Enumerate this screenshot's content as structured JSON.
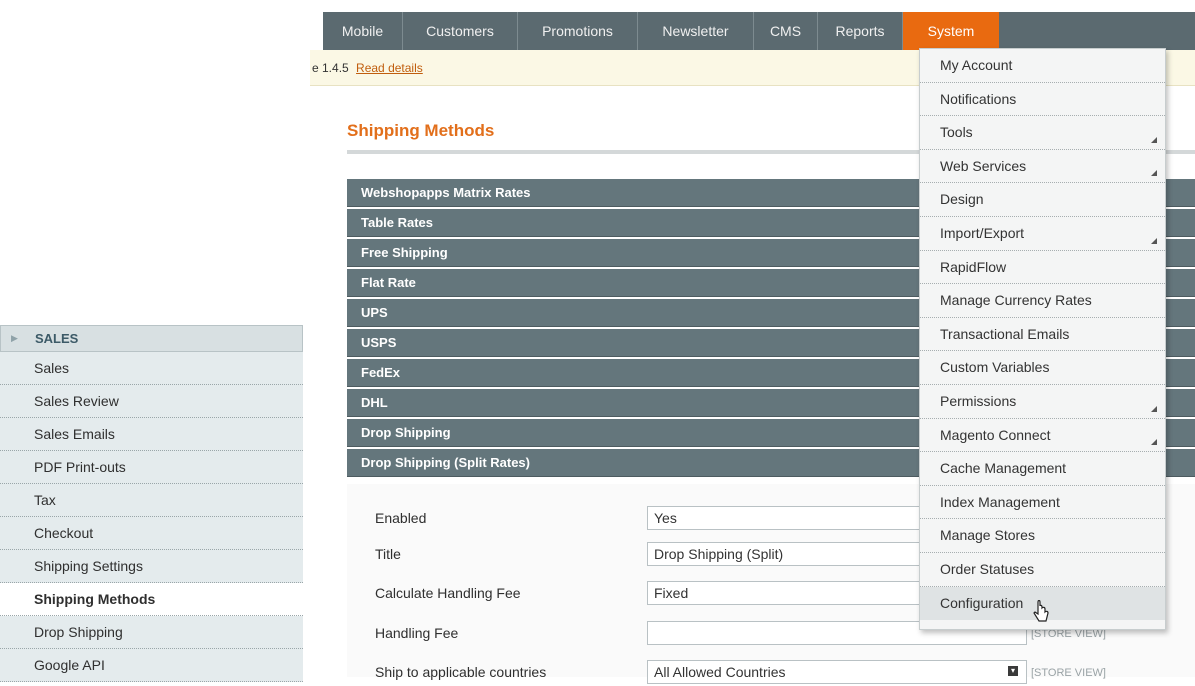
{
  "nav": {
    "items": [
      {
        "label": "Mobile",
        "width": 80
      },
      {
        "label": "Customers",
        "width": 115
      },
      {
        "label": "Promotions",
        "width": 120
      },
      {
        "label": "Newsletter",
        "width": 116
      },
      {
        "label": "CMS",
        "width": 64
      },
      {
        "label": "Reports",
        "width": 85
      }
    ],
    "active_label": "System"
  },
  "notice": {
    "text": "e 1.4.5",
    "link": "Read details"
  },
  "page": {
    "title": "Shipping Methods"
  },
  "sections": [
    "Webshopapps Matrix Rates",
    "Table Rates",
    "Free Shipping",
    "Flat Rate",
    "UPS",
    "USPS",
    "FedEx",
    "DHL",
    "Drop Shipping",
    "Drop Shipping (Split Rates)"
  ],
  "form": {
    "enabled": {
      "label": "Enabled",
      "value": "Yes"
    },
    "title": {
      "label": "Title",
      "value": "Drop Shipping (Split)"
    },
    "calc_fee": {
      "label": "Calculate Handling Fee",
      "value": "Fixed"
    },
    "handling_fee": {
      "label": "Handling Fee",
      "value": "",
      "scope": "[STORE VIEW]"
    },
    "countries": {
      "label": "Ship to applicable countries",
      "value": "All Allowed Countries",
      "scope": "[STORE VIEW]"
    }
  },
  "sidebar": {
    "header": "SALES",
    "items": [
      "Sales",
      "Sales Review",
      "Sales Emails",
      "PDF Print-outs",
      "Tax",
      "Checkout",
      "Shipping Settings",
      "Shipping Methods",
      "Drop Shipping",
      "Google API"
    ],
    "active": "Shipping Methods"
  },
  "system_menu": {
    "items": [
      {
        "label": "My Account",
        "submenu": false
      },
      {
        "label": "Notifications",
        "submenu": false
      },
      {
        "label": "Tools",
        "submenu": true
      },
      {
        "label": "Web Services",
        "submenu": true
      },
      {
        "label": "Design",
        "submenu": false
      },
      {
        "label": "Import/Export",
        "submenu": true
      },
      {
        "label": "RapidFlow",
        "submenu": false
      },
      {
        "label": "Manage Currency Rates",
        "submenu": false
      },
      {
        "label": "Transactional Emails",
        "submenu": false
      },
      {
        "label": "Custom Variables",
        "submenu": false
      },
      {
        "label": "Permissions",
        "submenu": true
      },
      {
        "label": "Magento Connect",
        "submenu": true
      },
      {
        "label": "Cache Management",
        "submenu": false
      },
      {
        "label": "Index Management",
        "submenu": false
      },
      {
        "label": "Manage Stores",
        "submenu": false
      },
      {
        "label": "Order Statuses",
        "submenu": false
      },
      {
        "label": "Configuration",
        "submenu": false
      }
    ],
    "hovered": "Configuration"
  },
  "colors": {
    "nav_bg": "#5b6a70",
    "nav_active": "#e96a10",
    "title": "#e26f1b",
    "section_header": "#64767c"
  }
}
